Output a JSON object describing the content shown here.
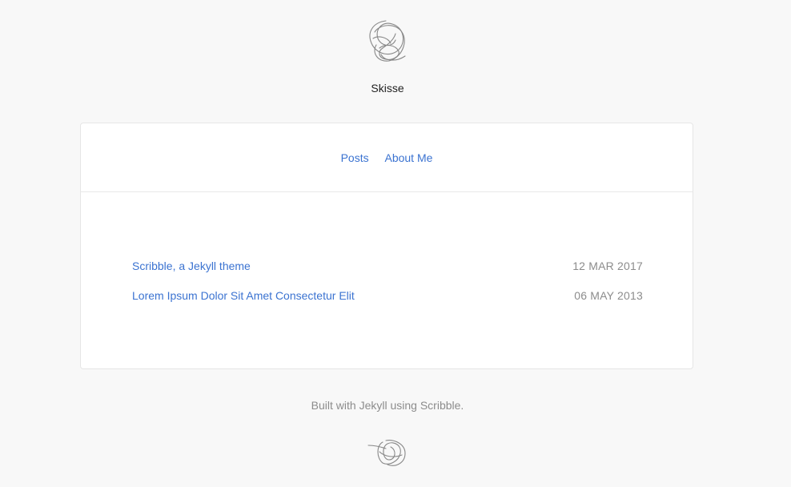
{
  "site": {
    "title": "Skisse"
  },
  "nav": {
    "items": [
      {
        "label": "Posts"
      },
      {
        "label": "About Me"
      }
    ]
  },
  "posts": [
    {
      "title": "Scribble, a Jekyll theme",
      "date": "12 MAR 2017"
    },
    {
      "title": "Lorem Ipsum Dolor Sit Amet Consectetur Elit",
      "date": "06 MAY 2013"
    }
  ],
  "footer": {
    "text": "Built with Jekyll using Scribble."
  },
  "colors": {
    "background": "#f8f8f8",
    "link": "#3b73d1",
    "muted": "#8c8c8c",
    "card": "#ffffff"
  },
  "icons": {
    "header_logo": "scribble-logo-icon",
    "footer_logo": "scribble-mark-icon"
  }
}
